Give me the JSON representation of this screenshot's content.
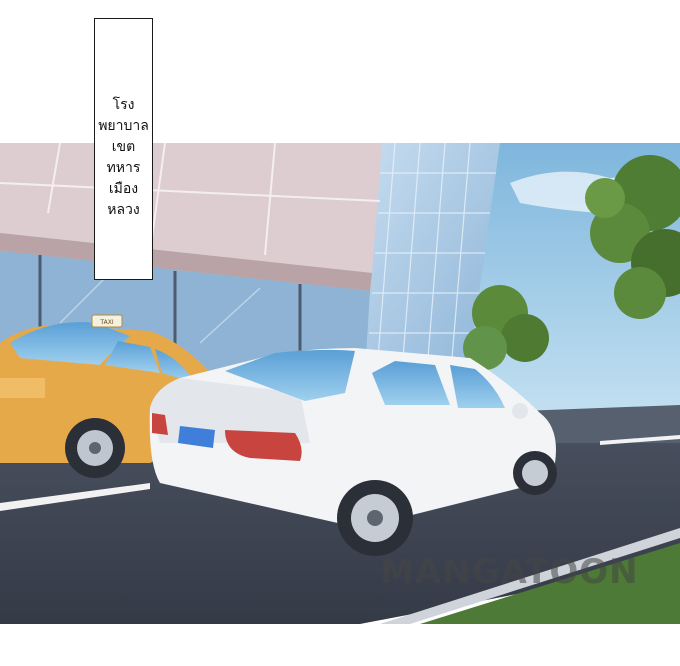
{
  "caption": {
    "lines": [
      "โรง",
      "พยาบาล",
      "เขต",
      "ทหาร",
      "เมือง",
      "หลวง"
    ]
  },
  "watermark": "MANGATOON",
  "taxi_sign": "TAXI",
  "colors": {
    "sky": "#9fcde8",
    "building_wall": "#d9c8cc",
    "glass": "#a9cbe6",
    "road": "#3d4452",
    "taxi": "#e5a94a",
    "sedan": "#f2f4f6",
    "foliage": "#5c8a3c",
    "plate": "#3f7fd9",
    "taillight": "#c8453f"
  }
}
